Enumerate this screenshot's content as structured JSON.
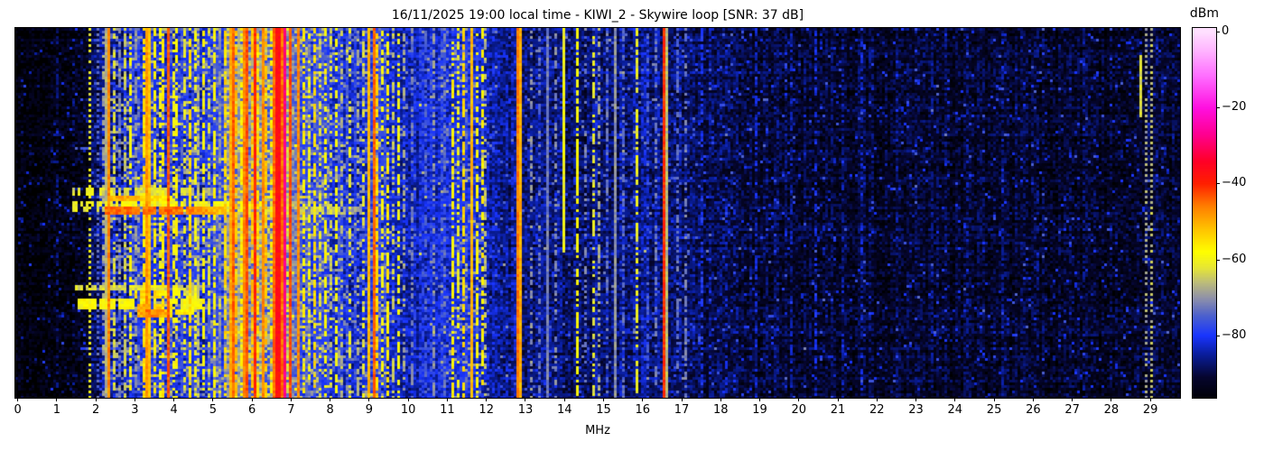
{
  "title": "16/11/2025 19:00 local time - KIWI_2 - Skywire loop [SNR: 37 dB]",
  "x_axis_label": "MHz",
  "colorbar_label": "dBm",
  "chart_data": {
    "type": "heatmap",
    "subtype": "radio-spectrogram-waterfall",
    "title": "16/11/2025 19:00 local time - KIWI_2 - Skywire loop [SNR: 37 dB]",
    "datetime_local": "16/11/2025 19:00",
    "station": "KIWI_2",
    "antenna": "Skywire loop",
    "snr_db": 37,
    "xlabel": "MHz",
    "x_range": [
      -0.06,
      29.76
    ],
    "x_ticks": [
      0,
      1,
      2,
      3,
      4,
      5,
      6,
      7,
      8,
      9,
      10,
      11,
      12,
      13,
      14,
      15,
      16,
      17,
      18,
      19,
      20,
      21,
      22,
      23,
      24,
      25,
      26,
      27,
      28,
      29
    ],
    "colorbar": {
      "label": "dBm",
      "vmax": 1,
      "vmin": -96.5,
      "ticks": [
        {
          "v": 0,
          "label": "0"
        },
        {
          "v": -20,
          "label": "−20"
        },
        {
          "v": -40,
          "label": "−40"
        },
        {
          "v": -60,
          "label": "−60"
        },
        {
          "v": -80,
          "label": "−80"
        }
      ]
    },
    "colormap_stops": [
      [
        -97.5,
        "#000000"
      ],
      [
        -91,
        "#06062e"
      ],
      [
        -85,
        "#0a1e9b"
      ],
      [
        -80,
        "#1a35ff"
      ],
      [
        -75,
        "#4a5fd0"
      ],
      [
        -70,
        "#9193a8"
      ],
      [
        -66,
        "#bdbd7a"
      ],
      [
        -62,
        "#e8e833"
      ],
      [
        -58,
        "#ffff00"
      ],
      [
        -52,
        "#ffc400"
      ],
      [
        -46,
        "#ff8000"
      ],
      [
        -40,
        "#ff2000"
      ],
      [
        -34,
        "#ff0028"
      ],
      [
        -27,
        "#ff0090"
      ],
      [
        -20,
        "#ff10e0"
      ],
      [
        -12,
        "#ff6aff"
      ],
      [
        -5,
        "#ffb4ff"
      ],
      [
        0,
        "#ffe0ff"
      ]
    ],
    "noise_floor_dbm": [
      [
        -0.06,
        -96
      ],
      [
        1.0,
        -95
      ],
      [
        1.7,
        -94
      ],
      [
        1.9,
        -90
      ],
      [
        2.1,
        -87
      ],
      [
        2.4,
        -84
      ],
      [
        3.0,
        -83
      ],
      [
        3.25,
        -78
      ],
      [
        3.55,
        -81
      ],
      [
        4.5,
        -80
      ],
      [
        5.2,
        -78
      ],
      [
        5.4,
        -73
      ],
      [
        6.0,
        -71
      ],
      [
        6.5,
        -73
      ],
      [
        7.0,
        -74
      ],
      [
        7.5,
        -77
      ],
      [
        8.1,
        -80
      ],
      [
        8.7,
        -82
      ],
      [
        9.1,
        -79
      ],
      [
        9.5,
        -82
      ],
      [
        10.2,
        -83
      ],
      [
        10.6,
        -81
      ],
      [
        11.1,
        -81
      ],
      [
        11.6,
        -79
      ],
      [
        12.1,
        -84
      ],
      [
        12.7,
        -86
      ],
      [
        13.5,
        -87
      ],
      [
        14.5,
        -88
      ],
      [
        15.2,
        -86
      ],
      [
        16.8,
        -87
      ],
      [
        17.5,
        -89
      ],
      [
        18.5,
        -90
      ],
      [
        20.0,
        -91
      ],
      [
        22.0,
        -91.5
      ],
      [
        25.0,
        -92
      ],
      [
        29.76,
        -92
      ]
    ],
    "speckle_bands": [
      {
        "f0": 2.3,
        "f1": 5.3,
        "p": 0.1,
        "d": -64
      },
      {
        "f0": 5.3,
        "f1": 6.5,
        "p": 0.38,
        "d": -62
      },
      {
        "f0": 6.5,
        "f1": 8.0,
        "p": 0.16,
        "d": -64
      },
      {
        "f0": 8.0,
        "f1": 9.5,
        "p": 0.1,
        "d": -66
      },
      {
        "f0": 10.8,
        "f1": 12.0,
        "p": 0.08,
        "d": -66
      },
      {
        "f0": 2.3,
        "f1": 9.5,
        "p": 0.12,
        "d": -72
      }
    ],
    "carriers": [
      {
        "f": 1.0,
        "d": -87,
        "s": "dash",
        "duty": 0.4
      },
      {
        "f": 1.45,
        "d": -86,
        "s": "dash",
        "duty": 0.35
      },
      {
        "f": 1.87,
        "d": -61,
        "s": "dot"
      },
      {
        "f": 2.05,
        "d": -74,
        "s": "dot"
      },
      {
        "f": 2.18,
        "d": -68,
        "s": "dash",
        "duty": 0.5
      },
      {
        "f": 2.27,
        "d": -67,
        "s": "solid"
      },
      {
        "f": 2.33,
        "d": -47,
        "s": "solid"
      },
      {
        "f": 2.5,
        "d": -63,
        "s": "dash",
        "duty": 0.6
      },
      {
        "f": 2.63,
        "d": -72,
        "s": "dash",
        "duty": 0.5
      },
      {
        "f": 2.77,
        "d": -64,
        "s": "dash",
        "duty": 0.55
      },
      {
        "f": 2.92,
        "d": -58,
        "s": "dash",
        "duty": 0.6
      },
      {
        "f": 3.05,
        "d": -70,
        "s": "dash",
        "duty": 0.5
      },
      {
        "f": 3.22,
        "d": -55,
        "s": "dash",
        "duty": 0.7
      },
      {
        "f": 3.3,
        "d": -48,
        "s": "solid"
      },
      {
        "f": 3.4,
        "d": -52,
        "s": "solid"
      },
      {
        "f": 3.5,
        "d": -57,
        "s": "dash",
        "duty": 0.65
      },
      {
        "f": 3.62,
        "d": -60,
        "s": "dash",
        "duty": 0.55
      },
      {
        "f": 3.74,
        "d": -56,
        "s": "dash",
        "duty": 0.6
      },
      {
        "f": 3.85,
        "d": -44,
        "s": "solid"
      },
      {
        "f": 3.98,
        "d": -60,
        "s": "dash",
        "duty": 0.5
      },
      {
        "f": 4.1,
        "d": -57,
        "s": "dash",
        "duty": 0.6
      },
      {
        "f": 4.24,
        "d": -62,
        "s": "dash",
        "duty": 0.5
      },
      {
        "f": 4.38,
        "d": -55,
        "s": "dash",
        "duty": 0.65
      },
      {
        "f": 4.52,
        "d": -60,
        "s": "dash",
        "duty": 0.5
      },
      {
        "f": 4.65,
        "d": -66,
        "s": "dash",
        "duty": 0.5
      },
      {
        "f": 4.78,
        "d": -58,
        "s": "dash",
        "duty": 0.6
      },
      {
        "f": 4.92,
        "d": -63,
        "s": "dash",
        "duty": 0.5
      },
      {
        "f": 5.05,
        "d": -58,
        "s": "dash",
        "duty": 0.55
      },
      {
        "f": 5.18,
        "d": -70,
        "s": "dash",
        "duty": 0.45
      },
      {
        "f": 5.33,
        "d": -54,
        "s": "dash",
        "duty": 0.7
      },
      {
        "f": 5.42,
        "d": -50,
        "s": "solid"
      },
      {
        "f": 5.52,
        "d": -44,
        "s": "solid"
      },
      {
        "f": 5.62,
        "d": -52,
        "s": "dash",
        "duty": 0.7
      },
      {
        "f": 5.7,
        "d": -57,
        "s": "dash",
        "duty": 0.6
      },
      {
        "f": 5.8,
        "d": -47,
        "s": "solid"
      },
      {
        "f": 5.9,
        "d": -43,
        "s": "solid"
      },
      {
        "f": 6.0,
        "d": -52,
        "s": "dash",
        "duty": 0.7
      },
      {
        "f": 6.08,
        "d": -40,
        "s": "solid"
      },
      {
        "f": 6.18,
        "d": -54,
        "s": "dash",
        "duty": 0.6
      },
      {
        "f": 6.28,
        "d": -47,
        "s": "solid"
      },
      {
        "f": 6.38,
        "d": -52,
        "s": "dash",
        "duty": 0.65
      },
      {
        "f": 6.46,
        "d": -57,
        "s": "dash",
        "duty": 0.5
      },
      {
        "f": 6.66,
        "d": -37,
        "s": "solid",
        "w": 4
      },
      {
        "f": 6.84,
        "d": -28,
        "s": "solid"
      },
      {
        "f": 6.93,
        "d": -63,
        "s": "dash",
        "duty": 0.5
      },
      {
        "f": 7.01,
        "d": -43,
        "s": "solid"
      },
      {
        "f": 7.2,
        "d": -47,
        "s": "solid"
      },
      {
        "f": 7.32,
        "d": -56,
        "s": "dash",
        "duty": 0.6
      },
      {
        "f": 7.45,
        "d": -60,
        "s": "dash",
        "duty": 0.5
      },
      {
        "f": 7.58,
        "d": -55,
        "s": "dash",
        "duty": 0.55
      },
      {
        "f": 7.72,
        "d": -62,
        "s": "dash",
        "duty": 0.45
      },
      {
        "f": 7.86,
        "d": -58,
        "s": "dash",
        "duty": 0.5
      },
      {
        "f": 8.0,
        "d": -64,
        "s": "dash",
        "duty": 0.45
      },
      {
        "f": 8.15,
        "d": -59,
        "s": "dash",
        "duty": 0.5
      },
      {
        "f": 8.32,
        "d": -66,
        "s": "dash",
        "duty": 0.4
      },
      {
        "f": 8.5,
        "d": -61,
        "s": "dash",
        "duty": 0.5
      },
      {
        "f": 8.68,
        "d": -67,
        "s": "dash",
        "duty": 0.4
      },
      {
        "f": 8.85,
        "d": -62,
        "s": "dash",
        "duty": 0.45
      },
      {
        "f": 9.02,
        "d": -51,
        "s": "solid"
      },
      {
        "f": 9.1,
        "d": -44,
        "s": "solid"
      },
      {
        "f": 9.21,
        "d": -54,
        "s": "dash",
        "duty": 0.7
      },
      {
        "f": 9.33,
        "d": -59,
        "s": "dash",
        "duty": 0.55
      },
      {
        "f": 9.47,
        "d": -56,
        "s": "dash",
        "duty": 0.6
      },
      {
        "f": 9.6,
        "d": -65,
        "s": "dash",
        "duty": 0.45
      },
      {
        "f": 9.72,
        "d": -59,
        "s": "dash",
        "duty": 0.55
      },
      {
        "f": 9.86,
        "d": -68,
        "s": "dash",
        "duty": 0.4
      },
      {
        "f": 10.12,
        "d": -72,
        "s": "dash",
        "duty": 0.5
      },
      {
        "f": 10.45,
        "d": -75,
        "s": "dash",
        "duty": 0.5
      },
      {
        "f": 10.68,
        "d": -70,
        "s": "dash",
        "duty": 0.5
      },
      {
        "f": 10.9,
        "d": -73,
        "s": "dash",
        "duty": 0.4
      },
      {
        "f": 11.17,
        "d": -57,
        "s": "dash",
        "duty": 0.6
      },
      {
        "f": 11.3,
        "d": -61,
        "s": "dash",
        "duty": 0.5
      },
      {
        "f": 11.43,
        "d": -54,
        "s": "dash",
        "duty": 0.65
      },
      {
        "f": 11.6,
        "d": -51,
        "s": "solid"
      },
      {
        "f": 11.73,
        "d": -59,
        "s": "dash",
        "duty": 0.55
      },
      {
        "f": 11.88,
        "d": -57,
        "s": "dash",
        "duty": 0.5
      },
      {
        "f": 12.0,
        "d": -66,
        "s": "dash",
        "duty": 0.4
      },
      {
        "f": 12.79,
        "d": -46,
        "s": "solid"
      },
      {
        "f": 12.88,
        "d": -50,
        "s": "solid"
      },
      {
        "f": 13.15,
        "d": -70,
        "s": "dash",
        "duty": 0.4
      },
      {
        "f": 13.38,
        "d": -73,
        "s": "dash",
        "duty": 0.4
      },
      {
        "f": 13.6,
        "d": -72,
        "s": "solid"
      },
      {
        "f": 13.8,
        "d": -71,
        "s": "dash",
        "duty": 0.4
      },
      {
        "f": 14.0,
        "d": -60,
        "s": "solid",
        "r0": 0,
        "r1": 0.6
      },
      {
        "f": 14.32,
        "d": -58,
        "s": "dash",
        "duty": 0.75
      },
      {
        "f": 14.55,
        "d": -72,
        "s": "dash",
        "duty": 0.4
      },
      {
        "f": 14.72,
        "d": -62,
        "s": "dash",
        "duty": 0.5
      },
      {
        "f": 14.9,
        "d": -68,
        "s": "dash",
        "duty": 0.45
      },
      {
        "f": 15.1,
        "d": -73,
        "s": "dash",
        "duty": 0.45
      },
      {
        "f": 15.33,
        "d": -70,
        "s": "solid"
      },
      {
        "f": 15.52,
        "d": -74,
        "s": "dash",
        "duty": 0.5
      },
      {
        "f": 15.85,
        "d": -61,
        "s": "dash",
        "duty": 0.6
      },
      {
        "f": 16.1,
        "d": -76,
        "s": "dash",
        "duty": 0.4
      },
      {
        "f": 16.35,
        "d": -73,
        "s": "dash",
        "duty": 0.4
      },
      {
        "f": 16.52,
        "d": -41,
        "s": "solid"
      },
      {
        "f": 16.6,
        "d": -66,
        "s": "solid"
      },
      {
        "f": 16.9,
        "d": -74,
        "s": "dash",
        "duty": 0.5
      },
      {
        "f": 17.08,
        "d": -72,
        "s": "dash",
        "duty": 0.45
      },
      {
        "f": 17.55,
        "d": -80,
        "s": "dash",
        "duty": 0.4
      },
      {
        "f": 18.15,
        "d": -83,
        "s": "dash",
        "duty": 0.4
      },
      {
        "f": 18.9,
        "d": -82,
        "s": "dash",
        "duty": 0.4
      },
      {
        "f": 19.8,
        "d": -84,
        "s": "dash",
        "duty": 0.35
      },
      {
        "f": 20.42,
        "d": -81,
        "s": "dash",
        "duty": 0.45
      },
      {
        "f": 21.1,
        "d": -84,
        "s": "dash",
        "duty": 0.35
      },
      {
        "f": 21.6,
        "d": -83,
        "s": "dash",
        "duty": 0.35
      },
      {
        "f": 22.5,
        "d": -85,
        "s": "dash",
        "duty": 0.3
      },
      {
        "f": 23.4,
        "d": -85,
        "s": "dash",
        "duty": 0.3
      },
      {
        "f": 24.3,
        "d": -85,
        "s": "dash",
        "duty": 0.3
      },
      {
        "f": 25.2,
        "d": -85,
        "s": "dash",
        "duty": 0.3
      },
      {
        "f": 26.15,
        "d": -86,
        "s": "dash",
        "duty": 0.3
      },
      {
        "f": 27.3,
        "d": -86,
        "s": "dash",
        "duty": 0.3
      },
      {
        "f": 28.72,
        "d": -63,
        "s": "solid",
        "r0": 0.07,
        "r1": 0.24
      },
      {
        "f": 28.88,
        "d": -68,
        "s": "dot"
      },
      {
        "f": 29.06,
        "d": -66,
        "s": "dot"
      }
    ],
    "bursts": [
      {
        "r0": 59,
        "r1": 61,
        "f0": 1.38,
        "f1": 5.05,
        "d": -62,
        "p": 0.75
      },
      {
        "r0": 62,
        "r1": 63,
        "f0": 2.3,
        "f1": 3.95,
        "d": -50,
        "p": 0.85
      },
      {
        "r0": 64,
        "r1": 65,
        "f0": 1.4,
        "f1": 7.25,
        "d": -60,
        "p": 0.7
      },
      {
        "r0": 66,
        "r1": 68,
        "f0": 2.25,
        "f1": 5.35,
        "d": -45,
        "p": 0.9
      },
      {
        "r0": 66,
        "r1": 68,
        "f0": 5.35,
        "f1": 8.9,
        "d": -63,
        "p": 0.6
      },
      {
        "r0": 66,
        "r1": 67,
        "f0": 1.38,
        "f1": 2.25,
        "d": -58,
        "p": 0.7
      },
      {
        "r0": 95,
        "r1": 96,
        "f0": 1.45,
        "f1": 4.9,
        "d": -63,
        "p": 0.65
      },
      {
        "r0": 97,
        "r1": 99,
        "f0": 2.9,
        "f1": 4.55,
        "d": -55,
        "p": 0.8
      },
      {
        "r0": 100,
        "r1": 103,
        "f0": 1.42,
        "f1": 5.6,
        "d": -59,
        "p": 0.65
      },
      {
        "r0": 102,
        "r1": 106,
        "f0": 3.05,
        "f1": 3.95,
        "d": -48,
        "p": 0.9
      },
      {
        "r0": 104,
        "r1": 106,
        "f0": 3.28,
        "f1": 3.8,
        "d": -42,
        "p": 0.95
      },
      {
        "r0": 104,
        "r1": 105,
        "f0": 4.05,
        "f1": 4.55,
        "d": -50,
        "p": 0.85
      },
      {
        "r0": 14,
        "r1": 14,
        "f0": 2.2,
        "f1": 8.8,
        "d": -76,
        "p": 0.55
      },
      {
        "r0": 30,
        "r1": 30,
        "f0": 2.2,
        "f1": 6.5,
        "d": -77,
        "p": 0.5
      },
      {
        "r0": 44,
        "r1": 44,
        "f0": 1.5,
        "f1": 5.5,
        "d": -76,
        "p": 0.5
      },
      {
        "r0": 78,
        "r1": 78,
        "f0": 2.2,
        "f1": 7.5,
        "d": -77,
        "p": 0.5
      },
      {
        "r0": 118,
        "r1": 118,
        "f0": 1.6,
        "f1": 6.0,
        "d": -76,
        "p": 0.5
      },
      {
        "r0": 126,
        "r1": 126,
        "f0": 2.3,
        "f1": 9.0,
        "d": -78,
        "p": 0.5
      }
    ],
    "grid": {
      "cols": 430,
      "rows": 137,
      "cell": 3
    },
    "seed": 1337
  }
}
